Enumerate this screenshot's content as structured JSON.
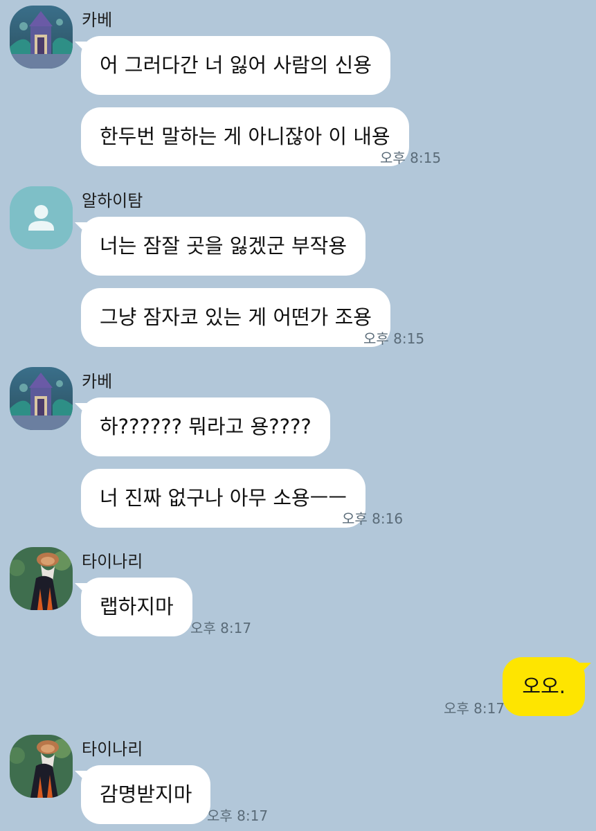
{
  "messages": [
    {
      "sender": "카베",
      "bubbles": [
        "어 그러다간 너 잃어 사람의 신용",
        "한두번 말하는 게 아니잖아 이 내용"
      ],
      "time": "오후 8:15"
    },
    {
      "sender": "알하이탐",
      "bubbles": [
        "너는 잠잘 곳을 잃겠군 부작용",
        "그냥 잠자코 있는 게 어떤가 조용"
      ],
      "time": "오후 8:15"
    },
    {
      "sender": "카베",
      "bubbles": [
        "하?????? 뭐라고 용????",
        "너 진짜 없구나 아무 소용ㅡㅡ"
      ],
      "time": "오후 8:16"
    },
    {
      "sender": "타이나리",
      "bubbles": [
        "랩하지마"
      ],
      "time": "오후 8:17"
    },
    {
      "mine": true,
      "bubbles": [
        "오오."
      ],
      "time": "오후 8:17"
    },
    {
      "sender": "타이나리",
      "bubbles": [
        "감명받지마"
      ],
      "time": "오후 8:17"
    }
  ],
  "avatars": {
    "kabe": "building-painting-avatar",
    "alhaitham": "default-person-icon",
    "tighnari": "character-portrait-avatar"
  },
  "colors": {
    "background": "#b2c7d9",
    "my_bubble": "#fee500",
    "other_bubble": "#ffffff",
    "default_avatar": "#7ebfc7"
  }
}
